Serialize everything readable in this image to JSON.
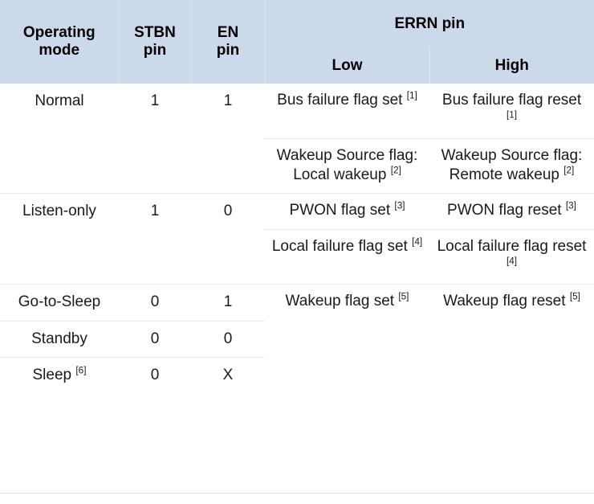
{
  "table": {
    "header": {
      "col_operating_mode": "Operating\nmode",
      "col_operating_mode_line1": "Operating",
      "col_operating_mode_line2": "mode",
      "col_stbn_line1": "STBN",
      "col_stbn_line2": "pin",
      "col_en_line1": "EN",
      "col_en_line2": "pin",
      "col_errn_pin": "ERRN pin",
      "col_errn_low": "Low",
      "col_errn_high": "High",
      "background_color": "#ccd9ea"
    },
    "rows": [
      {
        "mode": "Normal",
        "stbn": "1",
        "en": "1",
        "errn_low_text": "Bus failure flag set",
        "errn_low_ref": "[1]",
        "errn_high_text": "Bus failure flag reset",
        "errn_high_ref": "[1]"
      },
      {
        "mode": "",
        "stbn": "",
        "en": "",
        "errn_low_text": "Wakeup Source flag:  Local wakeup",
        "errn_low_ref": "[2]",
        "errn_high_text": "Wakeup Source flag: Remote wakeup",
        "errn_high_ref": "[2]"
      },
      {
        "mode": "Listen-only",
        "stbn": "1",
        "en": "0",
        "errn_low_text": "PWON flag set",
        "errn_low_ref": "[3]",
        "errn_high_text": "PWON flag reset",
        "errn_high_ref": "[3]"
      },
      {
        "mode": "",
        "stbn": "",
        "en": "",
        "errn_low_text": "Local failure flag set",
        "errn_low_ref": "[4]",
        "errn_high_text": "Local failure flag reset",
        "errn_high_ref": "[4]"
      },
      {
        "mode": "Go-to-Sleep",
        "stbn": "0",
        "en": "1",
        "errn_low_text": "Wakeup flag set",
        "errn_low_ref": "[5]",
        "errn_high_text": "Wakeup flag reset",
        "errn_high_ref": "[5]"
      },
      {
        "mode": "Standby",
        "stbn": "0",
        "en": "0",
        "errn_low_text": "",
        "errn_low_ref": "",
        "errn_high_text": "",
        "errn_high_ref": ""
      },
      {
        "mode": "Sleep",
        "mode_ref": "[6]",
        "stbn": "0",
        "en": "X",
        "errn_low_text": "",
        "errn_low_ref": "",
        "errn_high_text": "",
        "errn_high_ref": ""
      }
    ]
  },
  "colors": {
    "header_bg": "#ccd9ea",
    "rule": "#e6edf6",
    "text": "#1a1a1a"
  }
}
